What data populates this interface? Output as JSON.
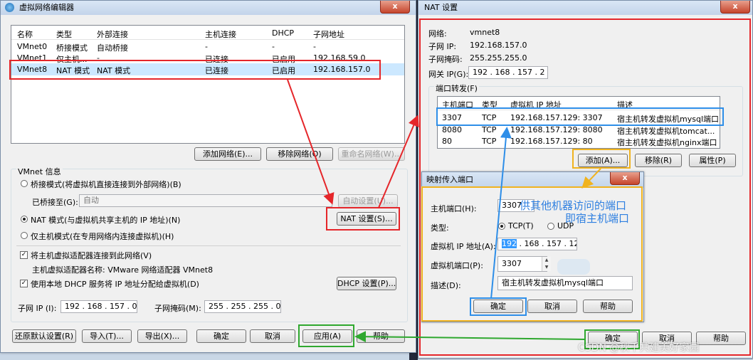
{
  "vne": {
    "title": "虚拟网络编辑器",
    "close": "x",
    "headers": [
      "名称",
      "类型",
      "外部连接",
      "主机连接",
      "DHCP",
      "子网地址"
    ],
    "rows": [
      [
        "VMnet0",
        "桥接模式",
        "自动桥接",
        "-",
        "-",
        "-"
      ],
      [
        "VMnet1",
        "仅主机...",
        "-",
        "已连接",
        "已启用",
        "192.168.59.0"
      ],
      [
        "VMnet8",
        "NAT 模式",
        "NAT 模式",
        "已连接",
        "已启用",
        "192.168.157.0"
      ]
    ],
    "btn_add": "添加网络(E)...",
    "btn_remove": "移除网络(O)",
    "btn_rename": "重命名网络(W)...",
    "info_title": "VMnet 信息",
    "opt_bridge": "桥接模式(将虚拟机直接连接到外部网络)(B)",
    "bridged_to_label": "已桥接至(G):",
    "bridged_to_value": "自动",
    "btn_auto": "自动设置(U)...",
    "opt_nat": "NAT 模式(与虚拟机共享主机的 IP 地址)(N)",
    "btn_nat": "NAT 设置(S)...",
    "opt_host": "仅主机模式(在专用网络内连接虚拟机)(H)",
    "chk_adapter": "将主机虚拟适配器连接到此网络(V)",
    "adapter_name": "主机虚拟适配器名称: VMware 网络适配器 VMnet8",
    "chk_dhcp": "使用本地 DHCP 服务将 IP 地址分配给虚拟机(D)",
    "btn_dhcp": "DHCP 设置(P)...",
    "subnet_ip_label": "子网 IP (I):",
    "subnet_ip": "192 . 168 . 157 . 0",
    "mask_label": "子网掩码(M):",
    "mask": "255 . 255 . 255 . 0",
    "btn_restore": "还原默认设置(R)",
    "btn_import": "导入(T)...",
    "btn_export": "导出(X)...",
    "btn_ok": "确定",
    "btn_cancel": "取消",
    "btn_apply": "应用(A)",
    "btn_help": "帮助"
  },
  "nat": {
    "title": "NAT 设置",
    "close": "x",
    "net_label": "网络:",
    "net_value": "vmnet8",
    "subnet_label": "子网 IP:",
    "subnet_value": "192.168.157.0",
    "mask_label": "子网掩码:",
    "mask_value": "255.255.255.0",
    "gw_label": "网关 IP(G):",
    "gw_value": "192 . 168 . 157 . 2",
    "pf_title": "端口转发(F)",
    "headers": [
      "主机端口",
      "类型",
      "虚拟机 IP 地址",
      "描述"
    ],
    "rows": [
      [
        "3307",
        "TCP",
        "192.168.157.129: 3307",
        "宿主机转发虚拟机mysql端口"
      ],
      [
        "8080",
        "TCP",
        "192.168.157.129: 8080",
        "宿主机转发虚拟机tomcat..."
      ],
      [
        "80",
        "TCP",
        "192.168.157.129: 80",
        "宿主机转发虚拟机nginx端口"
      ]
    ],
    "btn_add": "添加(A)...",
    "btn_remove": "移除(R)",
    "btn_props": "属性(P)",
    "btn_ok": "确定",
    "btn_cancel": "取消",
    "btn_help": "帮助"
  },
  "map": {
    "title": "映射传入端口",
    "host_port_label": "主机端口(H):",
    "host_port": "3307",
    "type_label": "类型:",
    "tcp": "TCP(T)",
    "udp": "UDP",
    "vm_ip_label": "虚拟机 IP 地址(A):",
    "vm_ip_sel": "192",
    "vm_ip_rest": " . 168 . 157 . 129",
    "vm_port_label": "虚拟机端口(P):",
    "vm_port": "3307",
    "desc_label": "描述(D):",
    "desc": "宿主机转发虚拟机mysql端口",
    "btn_ok": "确定",
    "btn_cancel": "取消",
    "btn_help": "帮助"
  },
  "annotation": {
    "line1": "供其他机器访问的端口",
    "line2": "即宿主机端口",
    "watermark": "CSDN @秋千共建美好家园"
  },
  "colors": {
    "red": "#e5262a",
    "blue": "#2e8ee8",
    "green": "#2fa82f",
    "orange": "#f0b31f",
    "annotation": "#2e7fe0"
  }
}
